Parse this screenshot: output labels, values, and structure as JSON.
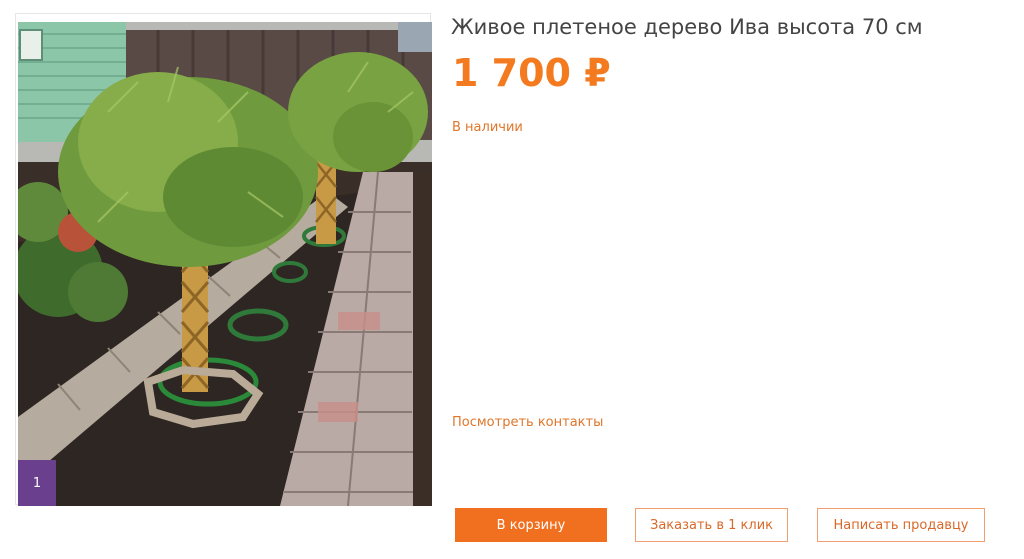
{
  "product": {
    "title": "Живое плетеное дерево Ива высота 70 см",
    "price": "1 700 ₽",
    "availability": "В наличии",
    "contacts_link": "Посмотреть контакты"
  },
  "gallery": {
    "image_alt": "photo of braided willow trees in a garden bed",
    "counter": "1"
  },
  "actions": {
    "cart_label": "В корзину",
    "one_click_label": "Заказать в 1 клик",
    "write_seller_label": "Написать продавцу"
  },
  "colors": {
    "accent": "#f47a20",
    "button_fill": "#f07020",
    "counter_badge": "#6a3f8e"
  }
}
